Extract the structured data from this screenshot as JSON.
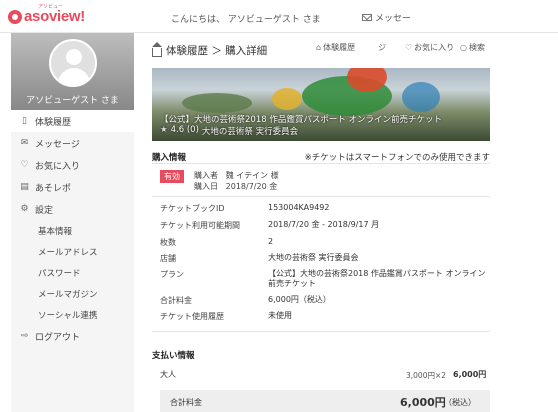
{
  "header": {
    "logo_text": "asoview!",
    "logo_ruby": "アソビュー",
    "greeting": "こんにちは、 アソビューゲスト さま",
    "message_label": "メッセー"
  },
  "sidebar": {
    "username": "アソビューゲスト さま",
    "items": [
      {
        "label": "体験履歴",
        "icon": "document-icon"
      },
      {
        "label": "メッセージ",
        "icon": "envelope-icon"
      },
      {
        "label": "お気に入り",
        "icon": "heart-icon"
      },
      {
        "label": "あそレポ",
        "icon": "notepad-icon"
      },
      {
        "label": "設定",
        "icon": "gear-icon"
      }
    ],
    "settings_items": [
      "基本情報",
      "メールアドレス",
      "パスワード",
      "メールマガジン",
      "ソーシャル連携"
    ],
    "logout": {
      "label": "ログアウト",
      "icon": "logout-arrow-icon"
    }
  },
  "main": {
    "breadcrumb": "体験履歴 ＞ 購入詳細",
    "topnav": {
      "history": "体験履歴",
      "report": "ジ",
      "favorites": "お気に入り",
      "search": "検索"
    },
    "hero": {
      "title": "【公式】大地の芸術祭2018 作品鑑賞パスポート オンライン前売チケット",
      "rating": "4.6 (0)",
      "organizer": "大地の芸術祭 実行委員会"
    },
    "purchase_info": {
      "heading": "購入情報",
      "note": "※チケットはスマートフォンでのみ使用できます",
      "status_badge": "有効",
      "buyer_label": "購入者",
      "buyer_value": "魏 イテイン 様",
      "date_label": "購入日",
      "date_value": "2018/7/20 金",
      "rows": [
        {
          "label": "チケットブックID",
          "value": "153004KA9492"
        },
        {
          "label": "チケット利用可能期間",
          "value": "2018/7/20 金 - 2018/9/17 月"
        },
        {
          "label": "枚数",
          "value": "2"
        },
        {
          "label": "店舗",
          "value": "大地の芸術祭 実行委員会"
        },
        {
          "label": "プラン",
          "value": "【公式】大地の芸術祭2018 作品鑑賞パスポート オンライン前売チケット"
        },
        {
          "label": "合計料金",
          "value": "6,000円（税込）"
        },
        {
          "label": "チケット使用履歴",
          "value": "未使用"
        }
      ]
    },
    "payment_info": {
      "heading": "支払い情報",
      "adult_label": "大人",
      "adult_unit": "3,000円×2",
      "adult_total": "6,000円",
      "total_label": "合計料金",
      "total_value": "6,000円",
      "tax_note": "（税込）"
    }
  }
}
